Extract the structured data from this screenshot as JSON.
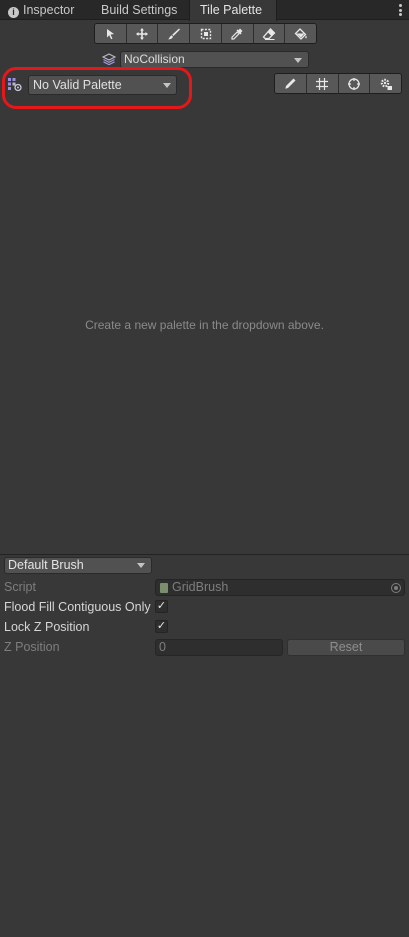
{
  "tabs": {
    "inspector": "Inspector",
    "build_settings": "Build Settings",
    "tile_palette": "Tile Palette"
  },
  "toolbar": {
    "tools": [
      "select-icon",
      "move-icon",
      "paint-brush-icon",
      "box-fill-icon",
      "picker-icon",
      "eraser-icon",
      "fill-bucket-icon"
    ]
  },
  "tilemap": {
    "active_target": "NoCollision"
  },
  "palette": {
    "selected": "No Valid Palette",
    "empty_message": "Create a new palette in the dropdown above.",
    "edit_tools": [
      "edit-pencil-icon",
      "grid-icon",
      "gizmo-icon",
      "settings-icon"
    ]
  },
  "brush": {
    "selected": "Default Brush",
    "script_label": "Script",
    "script_value": "GridBrush",
    "flood_fill_label": "Flood Fill Contiguous Only",
    "flood_fill_checked": true,
    "lock_z_label": "Lock Z Position",
    "lock_z_checked": true,
    "z_position_label": "Z Position",
    "z_position_value": "0",
    "reset_label": "Reset"
  },
  "colors": {
    "highlight": "#e4181a",
    "background": "#383838"
  }
}
